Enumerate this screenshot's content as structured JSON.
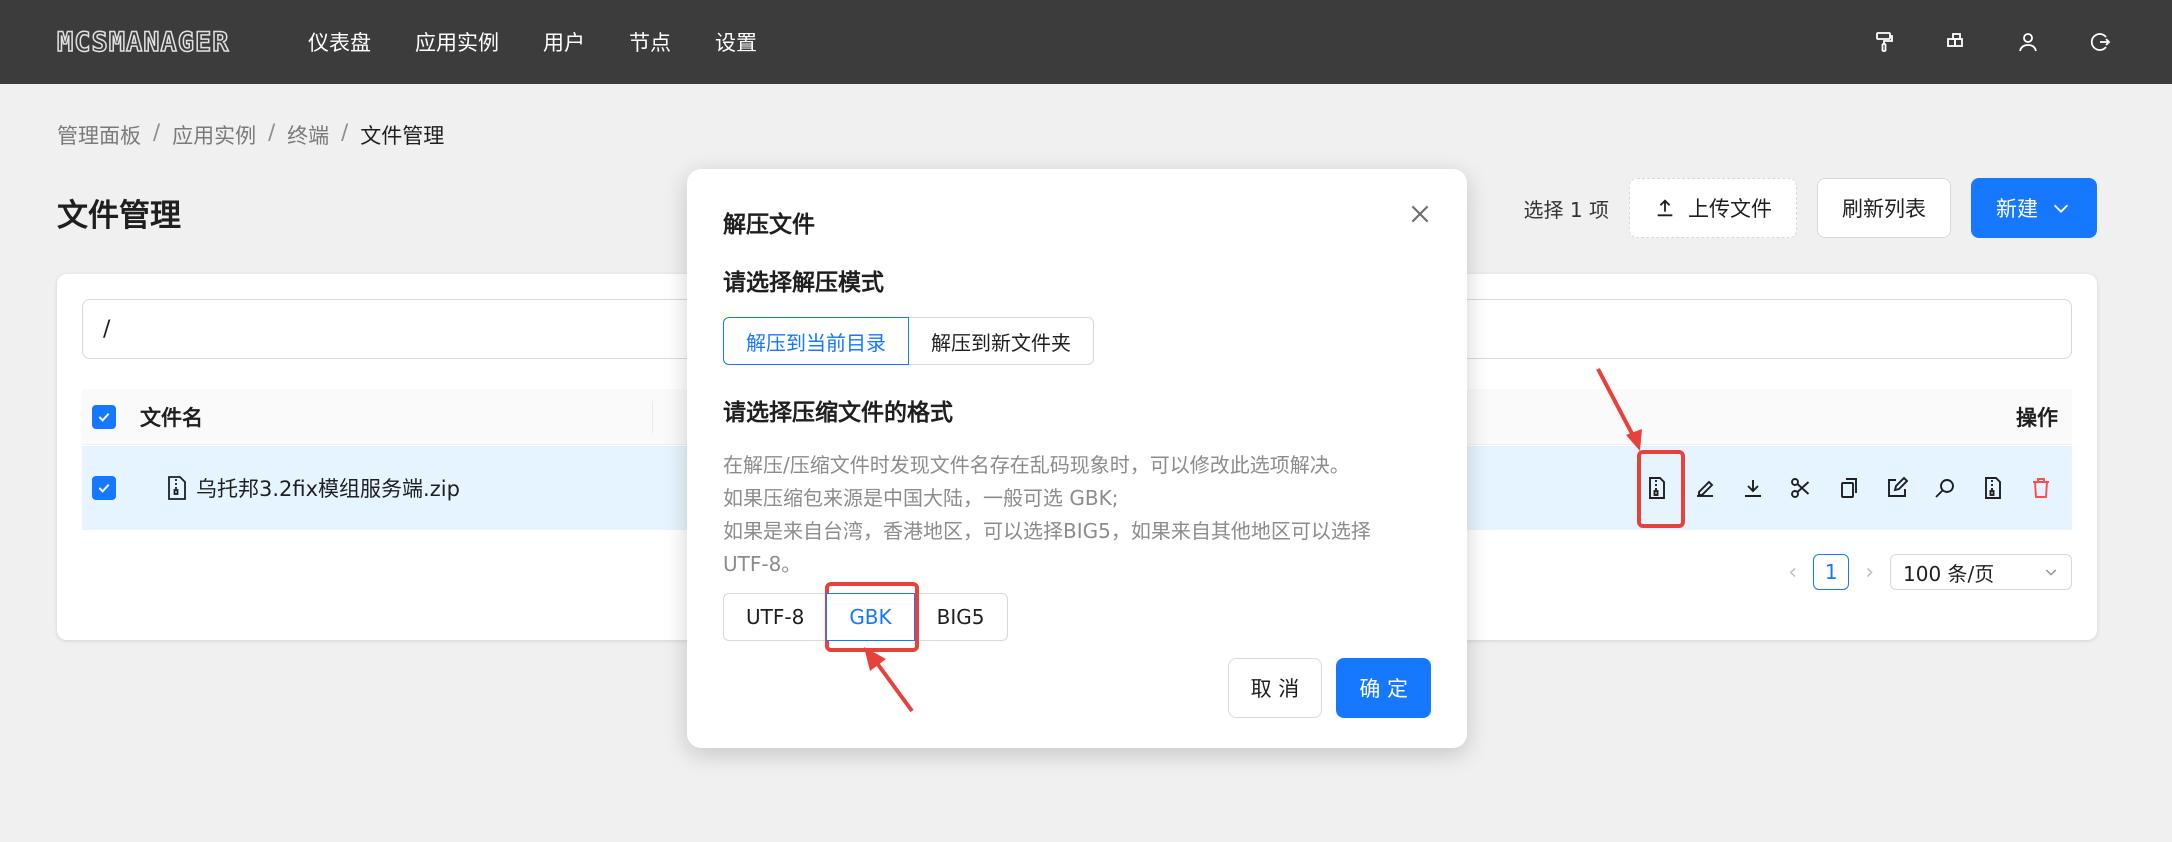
{
  "brand": {
    "logo_text": "MCSMANAGER"
  },
  "nav": {
    "items": [
      "仪表盘",
      "应用实例",
      "用户",
      "节点",
      "设置"
    ]
  },
  "top_icons": [
    "paint-roller-icon",
    "blocks-icon",
    "user-icon",
    "logout-icon"
  ],
  "breadcrumb": {
    "items": [
      "管理面板",
      "应用实例",
      "终端"
    ],
    "current": "文件管理",
    "separator": "/"
  },
  "page": {
    "title": "文件管理"
  },
  "toolbar": {
    "selected_text": "选择 1 项",
    "upload_label": "上传文件",
    "refresh_label": "刷新列表",
    "new_label": "新建"
  },
  "file_table": {
    "path": "/",
    "columns": {
      "name": "文件名",
      "operations": "操作"
    },
    "rows": [
      {
        "name": "乌托邦3.2fix模组服务端.zip",
        "selected": true
      }
    ]
  },
  "row_action_icons": [
    "unzip-icon",
    "rename-icon",
    "download-icon",
    "cut-icon",
    "copy-icon",
    "edit-icon",
    "view-icon",
    "permission-icon",
    "delete-icon"
  ],
  "pagination": {
    "current": "1",
    "page_size": "100 条/页"
  },
  "modal": {
    "title": "解压文件",
    "mode_heading": "请选择解压模式",
    "modes": [
      "解压到当前目录",
      "解压到新文件夹"
    ],
    "active_mode": "解压到当前目录",
    "format_heading": "请选择压缩文件的格式",
    "description_lines": [
      "在解压/压缩文件时发现文件名存在乱码现象时，可以修改此选项解决。",
      "如果压缩包来源是中国大陆，一般可选 GBK;",
      "如果是来自台湾，香港地区，可以选择BIG5，如果来自其他地区可以选择",
      "UTF-8。"
    ],
    "encodings": [
      "UTF-8",
      "GBK",
      "BIG5"
    ],
    "active_encoding": "GBK",
    "cancel_label": "取 消",
    "confirm_label": "确 定"
  },
  "colors": {
    "topbar": "#3c3c3c",
    "primary": "#1677ff",
    "danger": "#ff4d4f",
    "annotation": "#e8413c",
    "row_selected": "#e6f4ff"
  }
}
